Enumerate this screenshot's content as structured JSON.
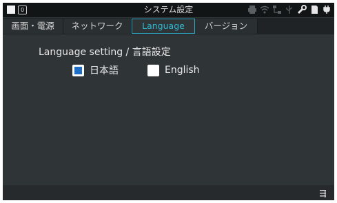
{
  "window": {
    "title": "システム設定"
  },
  "tabs": [
    {
      "label": "画面・電源",
      "active": false
    },
    {
      "label": "ネットワーク",
      "active": false
    },
    {
      "label": "Language",
      "active": true
    },
    {
      "label": "バージョン",
      "active": false
    }
  ],
  "language": {
    "heading": "Language setting / 言語設定",
    "options": [
      {
        "label": "日本語",
        "checked": true
      },
      {
        "label": "English",
        "checked": false
      }
    ]
  },
  "status_icons": [
    "printer-icon",
    "wifi-icon",
    "network-icon",
    "usb-icon",
    "tool-icon",
    "sd-card-icon",
    "power-plug-icon"
  ],
  "colors": {
    "accent": "#2ea7c4",
    "checked": "#1f6ec7",
    "background": "#2f3436",
    "titlebar": "#121516"
  },
  "chk_indicator": "zero"
}
